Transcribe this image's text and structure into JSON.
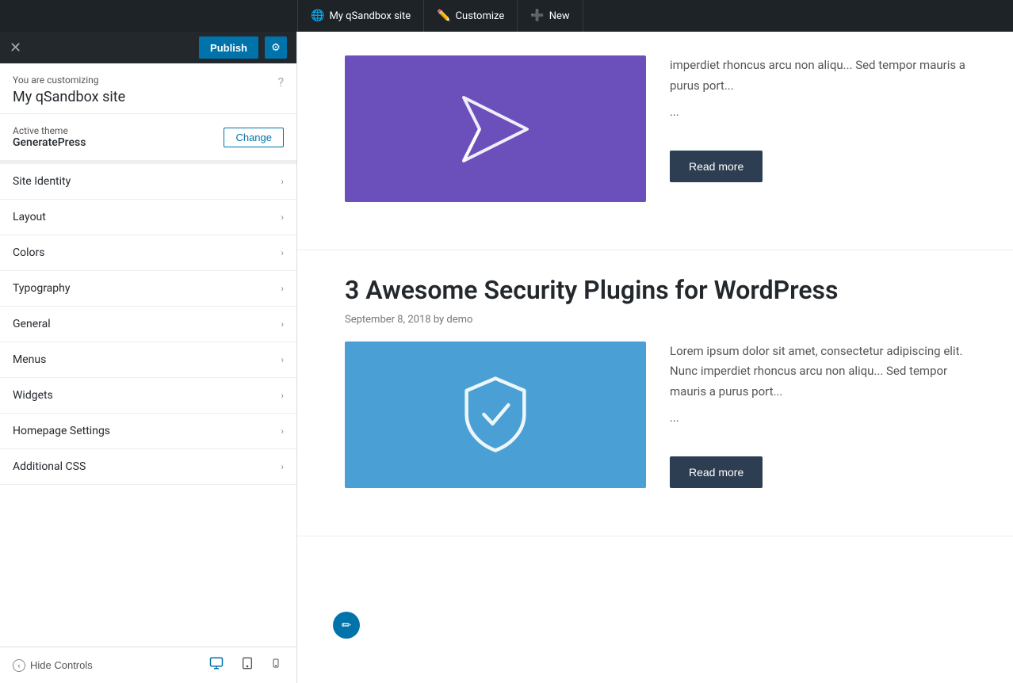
{
  "topbar": {
    "site_icon": "🌐",
    "tabs": [
      {
        "id": "my-site",
        "icon": "🌐",
        "label": "My qSandbox site"
      },
      {
        "id": "customize",
        "icon": "✏️",
        "label": "Customize"
      },
      {
        "id": "new",
        "icon": "➕",
        "label": "New"
      }
    ]
  },
  "sidebar": {
    "close_icon": "✕",
    "publish_label": "Publish",
    "settings_icon": "⚙",
    "customizing_label": "You are customizing",
    "site_name": "My qSandbox site",
    "help_icon": "?",
    "active_theme_label": "Active theme",
    "theme_name": "GeneratePress",
    "change_btn_label": "Change",
    "menu_items": [
      {
        "id": "site-identity",
        "label": "Site Identity"
      },
      {
        "id": "layout",
        "label": "Layout"
      },
      {
        "id": "colors",
        "label": "Colors"
      },
      {
        "id": "typography",
        "label": "Typography"
      },
      {
        "id": "general",
        "label": "General"
      },
      {
        "id": "menus",
        "label": "Menus"
      },
      {
        "id": "widgets",
        "label": "Widgets"
      },
      {
        "id": "homepage-settings",
        "label": "Homepage Settings"
      },
      {
        "id": "additional-css",
        "label": "Additional CSS"
      }
    ],
    "footer": {
      "hide_controls_label": "Hide Controls",
      "device_desktop_icon": "🖥",
      "device_tablet_icon": "📱",
      "device_mobile_icon": "📲"
    }
  },
  "content": {
    "posts": [
      {
        "id": "post-1",
        "image_type": "purple",
        "image_icon": "paper-plane",
        "title": "",
        "meta": "",
        "excerpt_text": "imperdiet rhoncus arcu non aliq... Sed tempor mauris a purus port...",
        "excerpt_dots": "...",
        "read_more_label": "Read more"
      },
      {
        "id": "post-2",
        "image_type": "blue",
        "image_icon": "shield",
        "title": "3 Awesome Security Plugins for WordPress",
        "meta": "September 8, 2018 by demo",
        "excerpt_text": "Lorem ipsum dolor sit amet, consectetur adipiscing elit. Nunc imperdiet rhoncus arcu non aliqu... Sed tempor mauris a purus port...",
        "excerpt_dots": "...",
        "read_more_label": "Read more"
      }
    ]
  },
  "edit_pencil_icon": "✏"
}
